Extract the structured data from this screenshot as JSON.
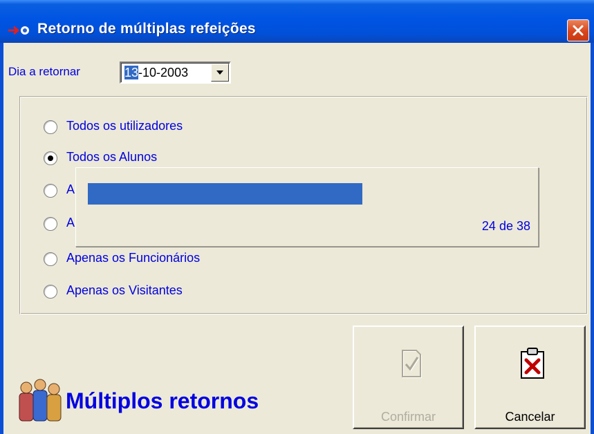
{
  "window": {
    "title": "Retorno de múltiplas refeições",
    "close_label": "close"
  },
  "date": {
    "label": "Dia a retornar",
    "value_selected": "13",
    "value_rest": "-10-2003"
  },
  "radio_options": [
    {
      "label": "Todos os utilizadores",
      "checked": false
    },
    {
      "label": "Todos os Alunos",
      "checked": true
    },
    {
      "label": "A",
      "checked": false
    },
    {
      "label": "A",
      "checked": false
    },
    {
      "label": "Apenas os Funcionários",
      "checked": false
    },
    {
      "label": "Apenas os Visitantes",
      "checked": false
    }
  ],
  "progress": {
    "current": 24,
    "total": 38,
    "text": "24 de 38"
  },
  "buttons": {
    "confirm": {
      "label": "Confirmar",
      "enabled": false
    },
    "cancel": {
      "label": "Cancelar",
      "enabled": true
    }
  },
  "brand": {
    "text": "Múltiplos retornos"
  },
  "colors": {
    "title_bar": "#0054e3",
    "text_blue": "#0000e0",
    "progress_fill": "#316ac5",
    "dialog_bg": "#ece9d8"
  },
  "icons": {
    "title": "arrow-star-icon",
    "close": "close-icon",
    "confirm": "checkmark-document-icon",
    "cancel": "clipboard-x-icon",
    "brand": "people-group-icon"
  }
}
